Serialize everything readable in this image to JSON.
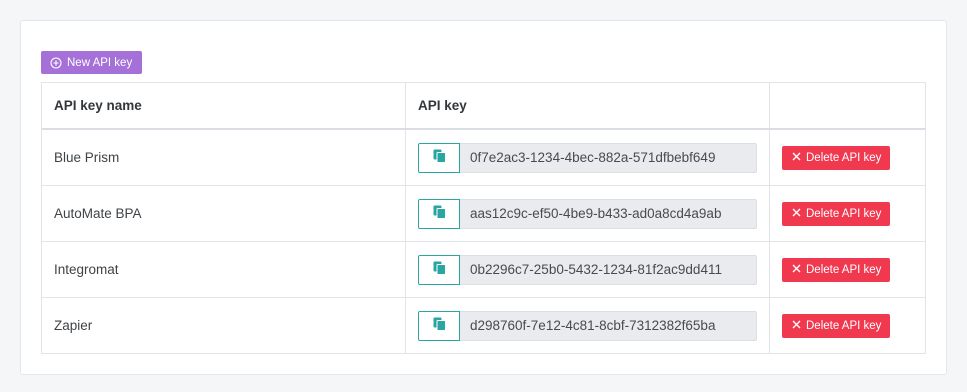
{
  "toolbar": {
    "new_key_label": "New API key"
  },
  "table": {
    "headers": {
      "name": "API key name",
      "key": "API key",
      "actions": ""
    },
    "rows": [
      {
        "name": "Blue Prism",
        "key": "0f7e2ac3-1234-4bec-882a-571dfbebf649",
        "delete_label": "Delete API key"
      },
      {
        "name": "AutoMate BPA",
        "key": "aas12c9c-ef50-4be9-b433-ad0a8cd4a9ab",
        "delete_label": "Delete API key"
      },
      {
        "name": "Integromat",
        "key": "0b2296c7-25b0-5432-1234-81f2ac9dd411",
        "delete_label": "Delete API key"
      },
      {
        "name": "Zapier",
        "key": "d298760f-7e12-4c81-8cbf-7312382f65ba",
        "delete_label": "Delete API key"
      }
    ]
  },
  "icons": {
    "new": "plus-circle-icon",
    "copy": "copy-icon",
    "delete": "close-icon"
  },
  "colors": {
    "primary": "#a571d8",
    "copy_accent": "#2aa6a0",
    "danger": "#f0394f"
  }
}
